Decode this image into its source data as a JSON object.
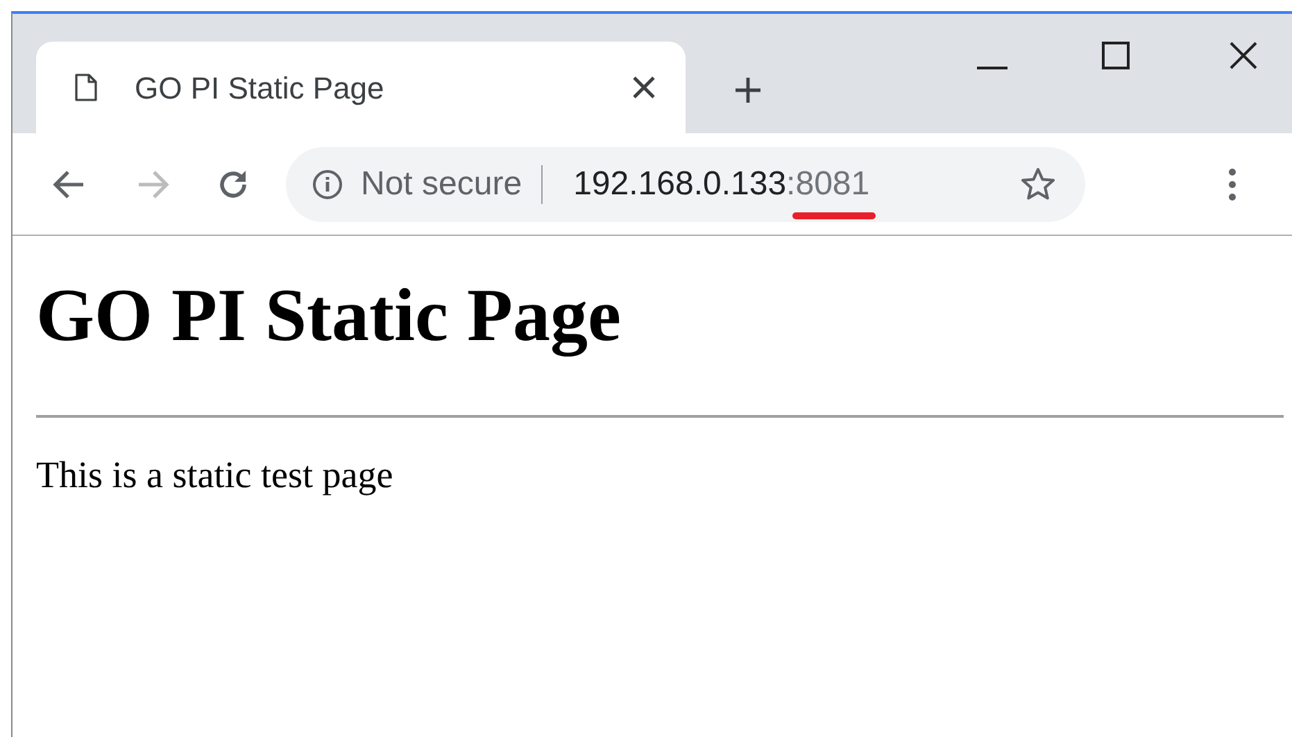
{
  "tabs": [
    {
      "title": "GO PI Static Page",
      "selected": true
    }
  ],
  "address_bar": {
    "security": "Not secure",
    "host": "192.168.0.133",
    "port": ":8081",
    "port_underlined": true
  },
  "page": {
    "heading": "GO PI Static Page",
    "paragraph": "This is a static test page"
  }
}
